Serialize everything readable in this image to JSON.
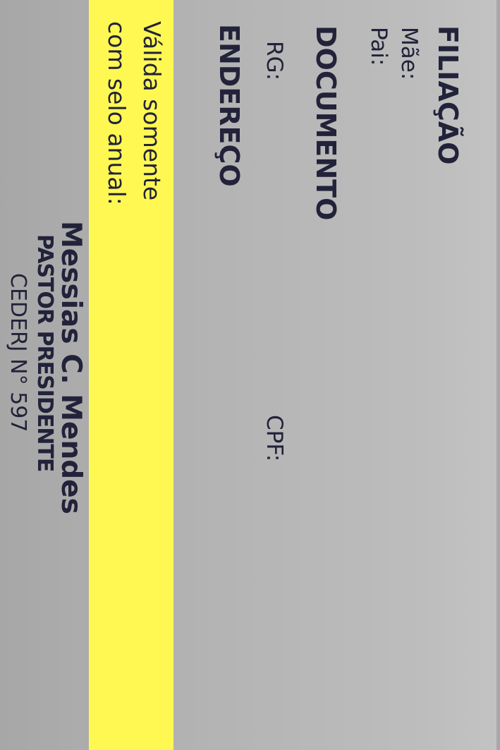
{
  "filiacao": {
    "heading": "FILIAÇÃO",
    "mae_label": "Mãe:",
    "pai_label": "Pai:"
  },
  "documento": {
    "heading": "DOCUMENTO",
    "rg_label": "RG:",
    "cpf_label": "CPF:"
  },
  "endereco": {
    "heading": "ENDEREÇO"
  },
  "validity": {
    "line1": "Válida somente",
    "line2": "com selo anual:"
  },
  "signature": {
    "name": "Messias C. Mendes",
    "role": "PASTOR PRESIDENTE",
    "registration": "CEDERJ N° 597"
  },
  "colors": {
    "stripe": "#fff852",
    "text": "#22223a",
    "background": "#b5b5b5"
  }
}
